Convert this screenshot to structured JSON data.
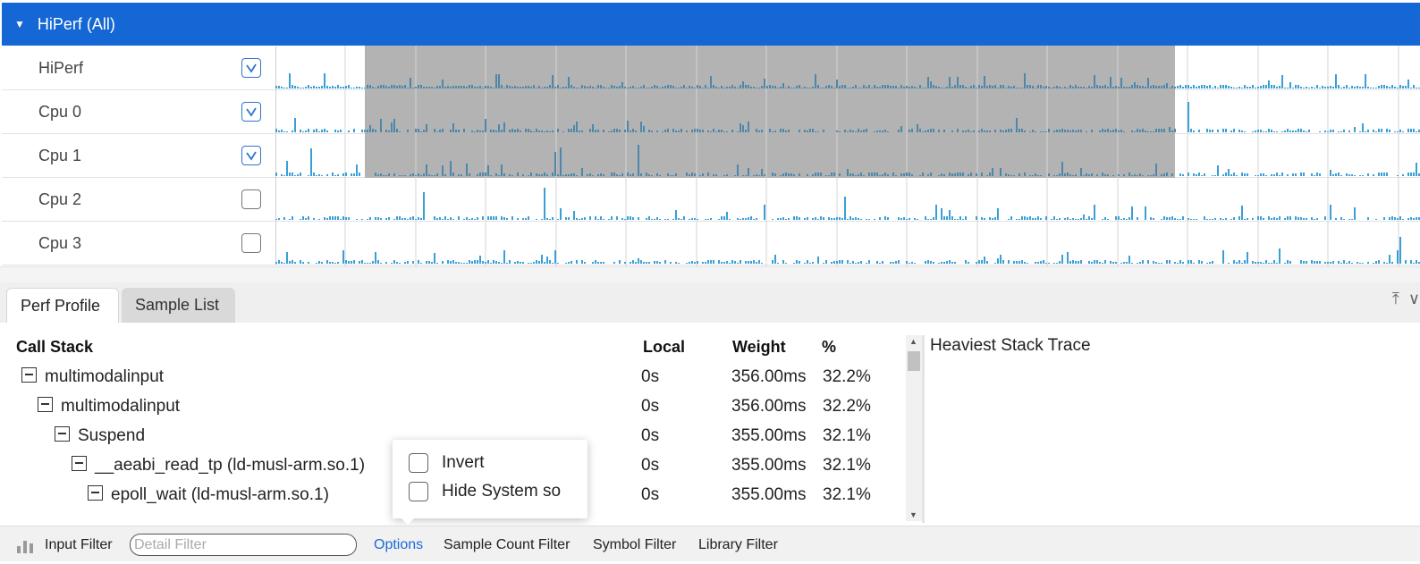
{
  "group": {
    "title": "HiPerf (All)",
    "expanded": true
  },
  "lanes": [
    {
      "name": "HiPerf",
      "checked": true
    },
    {
      "name": "Cpu 0",
      "checked": true
    },
    {
      "name": "Cpu 1",
      "checked": true
    },
    {
      "name": "Cpu 2",
      "checked": false
    },
    {
      "name": "Cpu 3",
      "checked": false
    }
  ],
  "colors": {
    "header": "#1467d4",
    "bar": "#3a9fd6",
    "selection": "#b3b3b3",
    "link": "#1a6ad8"
  },
  "tabs": [
    {
      "label": "Perf Profile",
      "active": true
    },
    {
      "label": "Sample List",
      "active": false
    }
  ],
  "tab_icons": [
    "pin-top-icon",
    "chevron-down-icon"
  ],
  "columns": {
    "call_stack": "Call Stack",
    "local": "Local",
    "weight": "Weight",
    "percent": "%"
  },
  "rows": [
    {
      "name": "multimodalinput",
      "local": "0s",
      "weight": "356.00ms",
      "percent": "32.2%"
    },
    {
      "name": "multimodalinput",
      "local": "0s",
      "weight": "356.00ms",
      "percent": "32.2%"
    },
    {
      "name": "Suspend",
      "local": "0s",
      "weight": "355.00ms",
      "percent": "32.1%"
    },
    {
      "name": "__aeabi_read_tp (ld-musl-arm.so.1)",
      "local": "0s",
      "weight": "355.00ms",
      "percent": "32.1%"
    },
    {
      "name": "epoll_wait (ld-musl-arm.so.1)",
      "local": "0s",
      "weight": "355.00ms",
      "percent": "32.1%"
    }
  ],
  "heaviest_title": "Heaviest Stack Trace",
  "popup": {
    "invert_label": "Invert",
    "hide_system_so_label": "Hide System so"
  },
  "filter_bar": {
    "input_filter_label": "Input Filter",
    "detail_placeholder": "Detail Filter",
    "options_label": "Options",
    "sample_count_label": "Sample Count Filter",
    "symbol_filter_label": "Symbol Filter",
    "library_filter_label": "Library Filter"
  }
}
